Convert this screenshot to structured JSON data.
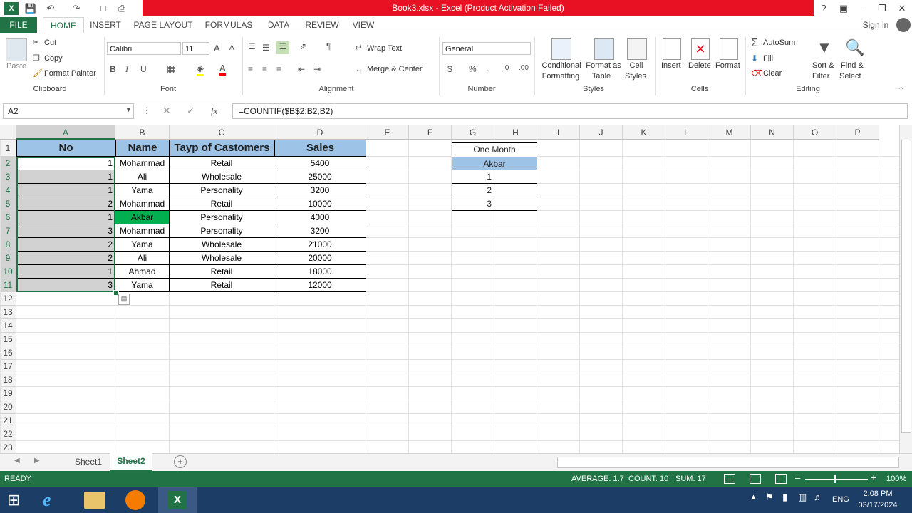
{
  "window": {
    "title": "Book3.xlsx -  Excel (Product Activation Failed)",
    "sign_in": "Sign in"
  },
  "tabs": [
    "FILE",
    "HOME",
    "INSERT",
    "PAGE LAYOUT",
    "FORMULAS",
    "DATA",
    "REVIEW",
    "VIEW"
  ],
  "ribbon": {
    "clipboard": {
      "paste": "Paste",
      "cut": "Cut",
      "copy": "Copy",
      "format_painter": "Format Painter",
      "label": "Clipboard"
    },
    "font": {
      "name": "Calibri",
      "size": "11",
      "bold": "B",
      "italic": "I",
      "underline": "U",
      "label": "Font"
    },
    "alignment": {
      "wrap": "Wrap Text",
      "merge": "Merge & Center",
      "label": "Alignment"
    },
    "number": {
      "format": "General",
      "currency": "$",
      "percent": "%",
      "comma": ",",
      "label": "Number"
    },
    "styles": {
      "conditional": "Conditional",
      "conditional2": "Formatting",
      "format_as": "Format as",
      "format_as2": "Table",
      "cell": "Cell",
      "cell2": "Styles",
      "label": "Styles"
    },
    "cells": {
      "insert": "Insert",
      "delete": "Delete",
      "format": "Format",
      "label": "Cells"
    },
    "editing": {
      "autosum": "AutoSum",
      "fill": "Fill",
      "clear": "Clear",
      "sort": "Sort &",
      "sort2": "Filter",
      "find": "Find &",
      "find2": "Select",
      "label": "Editing"
    }
  },
  "formula_bar": {
    "name_box": "A2",
    "fx": "fx",
    "formula": "=COUNTIF($B$2:B2,B2)"
  },
  "columns": [
    "A",
    "B",
    "C",
    "D",
    "E",
    "F",
    "G",
    "H",
    "I",
    "J",
    "K",
    "L",
    "M",
    "N",
    "O",
    "P"
  ],
  "rows": [
    "1",
    "2",
    "3",
    "4",
    "5",
    "6",
    "7",
    "8",
    "9",
    "10",
    "11",
    "12",
    "13",
    "14",
    "15",
    "16",
    "17",
    "18",
    "19",
    "20",
    "21",
    "22",
    "23"
  ],
  "table": {
    "headers": [
      "No",
      "Name",
      "Tayp of Castomers",
      "Sales"
    ],
    "rows": [
      [
        "1",
        "Mohammad",
        "Retail",
        "5400"
      ],
      [
        "1",
        "Ali",
        "Wholesale",
        "25000"
      ],
      [
        "1",
        "Yama",
        "Personality",
        "3200"
      ],
      [
        "2",
        "Mohammad",
        "Retail",
        "10000"
      ],
      [
        "1",
        "Akbar",
        "Personality",
        "4000"
      ],
      [
        "3",
        "Mohammad",
        "Personality",
        "3200"
      ],
      [
        "2",
        "Yama",
        "Wholesale",
        "21000"
      ],
      [
        "2",
        "Ali",
        "Wholesale",
        "20000"
      ],
      [
        "1",
        "Ahmad",
        "Retail",
        "18000"
      ],
      [
        "3",
        "Yama",
        "Retail",
        "12000"
      ]
    ]
  },
  "side_table": {
    "title": "One Month",
    "name": "Akbar",
    "values": [
      "1",
      "2",
      "3"
    ]
  },
  "sheets": [
    "Sheet1",
    "Sheet2"
  ],
  "status": {
    "ready": "READY",
    "average": "AVERAGE: 1.7",
    "count": "COUNT: 10",
    "sum": "SUM: 17",
    "zoom": "100%"
  },
  "taskbar": {
    "lang": "ENG",
    "time": "2:08 PM",
    "date": "03/17/2024"
  },
  "colors": {
    "excel_green": "#217346",
    "header_blue": "#9dc3e6",
    "highlight_green": "#00b050",
    "title_red": "#e81123"
  }
}
